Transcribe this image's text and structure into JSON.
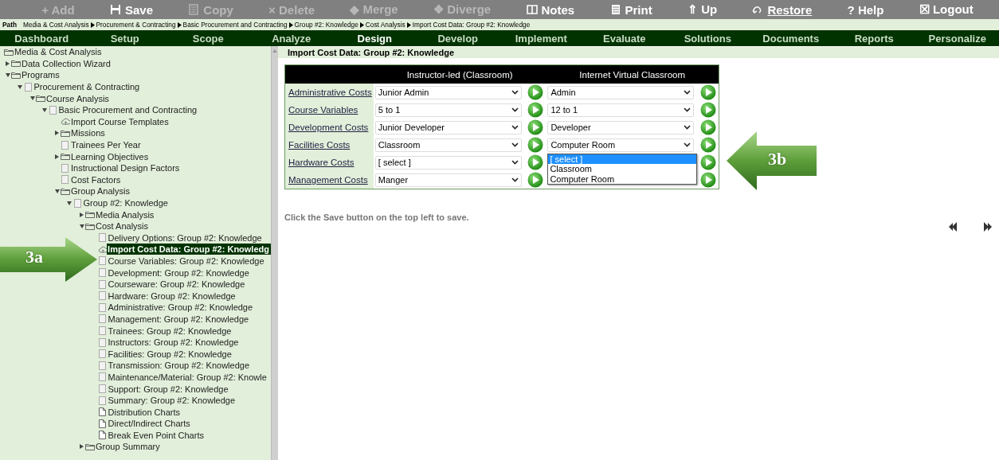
{
  "toolbar": [
    {
      "label": "+ Add",
      "kind": "plain",
      "disabled": true
    },
    {
      "label": "Save",
      "kind": "save",
      "disabled": false
    },
    {
      "label": "Copy",
      "kind": "copy",
      "disabled": true
    },
    {
      "label": "× Delete",
      "kind": "plain",
      "disabled": true
    },
    {
      "label": "◆ Merge",
      "kind": "plain",
      "disabled": true
    },
    {
      "label": "❖ Diverge",
      "kind": "plain",
      "disabled": true
    },
    {
      "label": "Notes",
      "kind": "notes",
      "disabled": false
    },
    {
      "label": "Print",
      "kind": "print",
      "disabled": false
    },
    {
      "label": "⇑ Up",
      "kind": "plain",
      "disabled": false
    },
    {
      "label": "Restore",
      "kind": "restore",
      "disabled": false
    },
    {
      "label": "? Help",
      "kind": "plain",
      "disabled": false
    },
    {
      "label": "☒ Logout",
      "kind": "plain",
      "disabled": false
    }
  ],
  "path": {
    "label": "Path",
    "crumbs": [
      "Media & Cost Analysis",
      "Procurement & Contracting",
      "Basic Procurement and Contracting",
      "Group #2: Knowledge",
      "Cost Analysis",
      "Import Cost Data: Group #2: Knowledge"
    ]
  },
  "nav": [
    {
      "label": "Dashboard",
      "selected": false
    },
    {
      "label": "Setup",
      "selected": false
    },
    {
      "label": "Scope",
      "selected": false
    },
    {
      "label": "Analyze",
      "selected": false
    },
    {
      "label": "Design",
      "selected": true
    },
    {
      "label": "Develop",
      "selected": false
    },
    {
      "label": "Implement",
      "selected": false
    },
    {
      "label": "Evaluate",
      "selected": false
    },
    {
      "label": "Solutions",
      "selected": false
    },
    {
      "label": "Documents",
      "selected": false
    },
    {
      "label": "Reports",
      "selected": false
    },
    {
      "label": "Personalize",
      "selected": false
    }
  ],
  "tree": {
    "label": "Media & Cost Analysis",
    "kind": "folder",
    "selected": false,
    "children": [
      {
        "label": "Data Collection Wizard",
        "kind": "folder",
        "expanded": false,
        "selected": false
      },
      {
        "label": "Programs",
        "kind": "folder",
        "expanded": true,
        "selected": false,
        "children": [
          {
            "label": "Procurement & Contracting",
            "kind": "page",
            "expanded": true,
            "selected": false,
            "children": [
              {
                "label": "Course Analysis",
                "kind": "folder",
                "expanded": true,
                "selected": false,
                "children": [
                  {
                    "label": "Basic Procurement and Contracting",
                    "kind": "page",
                    "expanded": true,
                    "selected": false,
                    "children": [
                      {
                        "label": "Import Course Templates",
                        "kind": "cloud",
                        "selected": false
                      },
                      {
                        "label": "Missions",
                        "kind": "folder",
                        "expanded": false,
                        "selected": false
                      },
                      {
                        "label": "Trainees Per Year",
                        "kind": "page",
                        "selected": false
                      },
                      {
                        "label": "Learning Objectives",
                        "kind": "folder",
                        "expanded": false,
                        "selected": false
                      },
                      {
                        "label": "Instructional Design Factors",
                        "kind": "page",
                        "selected": false
                      },
                      {
                        "label": "Cost Factors",
                        "kind": "page",
                        "selected": false
                      },
                      {
                        "label": "Group Analysis",
                        "kind": "folder",
                        "expanded": true,
                        "selected": false,
                        "children": [
                          {
                            "label": "Group #2: Knowledge",
                            "kind": "page",
                            "expanded": true,
                            "selected": false,
                            "children": [
                              {
                                "label": "Media Analysis",
                                "kind": "folder",
                                "expanded": false,
                                "selected": false
                              },
                              {
                                "label": "Cost Analysis",
                                "kind": "folder",
                                "expanded": true,
                                "selected": false,
                                "children": [
                                  {
                                    "label": "Delivery Options: Group #2: Knowledge",
                                    "kind": "page",
                                    "selected": false
                                  },
                                  {
                                    "label": "Import Cost Data: Group #2: Knowledg",
                                    "kind": "cloud",
                                    "selected": true
                                  },
                                  {
                                    "label": "Course Variables: Group #2: Knowledge",
                                    "kind": "page",
                                    "selected": false
                                  },
                                  {
                                    "label": "Development: Group #2: Knowledge",
                                    "kind": "page",
                                    "selected": false
                                  },
                                  {
                                    "label": "Courseware: Group #2: Knowledge",
                                    "kind": "page",
                                    "selected": false
                                  },
                                  {
                                    "label": "Hardware: Group #2: Knowledge",
                                    "kind": "page",
                                    "selected": false
                                  },
                                  {
                                    "label": "Administrative: Group #2: Knowledge",
                                    "kind": "page",
                                    "selected": false
                                  },
                                  {
                                    "label": "Management: Group #2: Knowledge",
                                    "kind": "page",
                                    "selected": false
                                  },
                                  {
                                    "label": "Trainees: Group #2: Knowledge",
                                    "kind": "page",
                                    "selected": false
                                  },
                                  {
                                    "label": "Instructors: Group #2: Knowledge",
                                    "kind": "page",
                                    "selected": false
                                  },
                                  {
                                    "label": "Facilities: Group #2: Knowledge",
                                    "kind": "page",
                                    "selected": false
                                  },
                                  {
                                    "label": "Transmission: Group #2: Knowledge",
                                    "kind": "page",
                                    "selected": false
                                  },
                                  {
                                    "label": "Maintenance/Material: Group #2: Knowle",
                                    "kind": "page",
                                    "selected": false
                                  },
                                  {
                                    "label": "Support: Group #2: Knowledge",
                                    "kind": "page",
                                    "selected": false
                                  },
                                  {
                                    "label": "Summary: Group #2: Knowledge",
                                    "kind": "page",
                                    "selected": false
                                  },
                                  {
                                    "label": "Distribution Charts",
                                    "kind": "doc",
                                    "selected": false
                                  },
                                  {
                                    "label": "Direct/Indirect Charts",
                                    "kind": "doc",
                                    "selected": false
                                  },
                                  {
                                    "label": "Break Even Point Charts",
                                    "kind": "doc",
                                    "selected": false
                                  }
                                ]
                              },
                              {
                                "label": "Group Summary",
                                "kind": "folder",
                                "expanded": false,
                                "selected": false
                              }
                            ]
                          }
                        ]
                      }
                    ]
                  }
                ]
              }
            ]
          }
        ]
      }
    ]
  },
  "content": {
    "title": "Import Cost Data: Group #2: Knowledge",
    "columns": [
      "Instructor-led (Classroom)",
      "Internet Virtual Classroom"
    ],
    "rows": [
      {
        "label": "Administrative Costs",
        "instructor_led": "Junior Admin",
        "virtual": "Admin"
      },
      {
        "label": "Course Variables",
        "instructor_led": "5 to 1",
        "virtual": "12 to 1"
      },
      {
        "label": "Development Costs",
        "instructor_led": "Junior Developer",
        "virtual": "Developer"
      },
      {
        "label": "Facilities Costs",
        "instructor_led": "Classroom",
        "virtual": "Computer Room",
        "dropdown": [
          {
            "label": "[ select ]",
            "selected": true
          },
          {
            "label": "Classroom",
            "selected": false
          },
          {
            "label": "Computer Room",
            "selected": false
          }
        ]
      },
      {
        "label": "Hardware Costs",
        "instructor_led": "[ select ]"
      },
      {
        "label": "Management Costs",
        "instructor_led": "Manger"
      }
    ],
    "message": "Click the Save button on the top left to save."
  },
  "callouts": [
    {
      "label": "3a",
      "kind": "right"
    },
    {
      "label": "3b",
      "kind": "left"
    }
  ]
}
